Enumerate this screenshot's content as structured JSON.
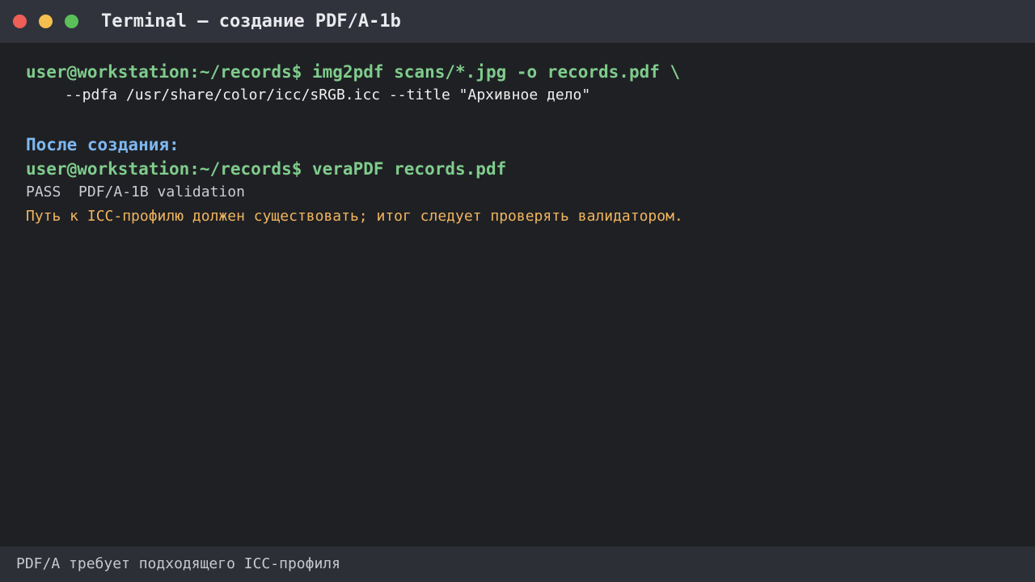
{
  "window": {
    "title": "Terminal — создание PDF/A-1b",
    "controls": {
      "close_color": "#ee5f57",
      "minimize_color": "#f4bf4e",
      "zoom_color": "#5ac05a"
    }
  },
  "terminal": {
    "command1": "user@workstation:~/records$ img2pdf scans/*.jpg -o records.pdf \\",
    "command1_continuation": "--pdfa /usr/share/color/icc/sRGB.icc --title \"Архивное дело\"",
    "section_heading": "После создания:",
    "command2": "user@workstation:~/records$ veraPDF records.pdf",
    "output_pass": "PASS  PDF/A-1B validation",
    "note": "Путь к ICC-профилю должен существовать; итог следует проверять валидатором."
  },
  "statusbar": {
    "text": "PDF/A требует подходящего ICC-профиля"
  },
  "colors": {
    "prompt": "#7fcc8c",
    "heading": "#7db8f0",
    "plain": "#f0f0f0",
    "output": "#c9ccd2",
    "warning": "#f0b55e",
    "status": "#c6c9d0"
  }
}
